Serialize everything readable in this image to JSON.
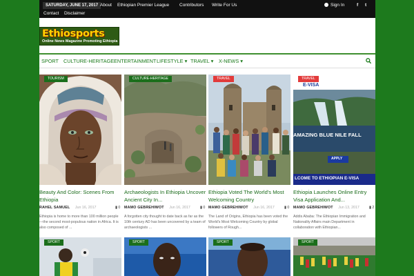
{
  "topbar": {
    "date": "SATURDAY, JUNE 17, 2017",
    "links": [
      "About",
      "Ethiopian Premier League",
      "Contributors",
      "Write For Us",
      "Contact",
      "Disclaimer"
    ],
    "signin": "Sign In",
    "social": [
      "f",
      "t"
    ]
  },
  "logo": {
    "brand": "Ethiosports",
    "tagline": "Online News Magazine Promoting Ethiopia"
  },
  "menu": {
    "items": [
      "SPORT",
      "CULTURE-HERITAGE",
      "ENTERTAINMENT",
      "LIFESTYLE",
      "TRAVEL",
      "X-NEWS"
    ],
    "search_icon": "search-icon"
  },
  "articles": [
    {
      "category": "TOURISM",
      "title": "Beauty And Color: Scenes From Ethiopia",
      "author": "RAHEL SAMUEL",
      "date": "Jun 16, 2017",
      "comments": "0",
      "excerpt": "Ethiopia is home to more than 100 million people—the second most-populous nation in Africa. It is also composed of ..."
    },
    {
      "category": "CULTURE-HERITAGE",
      "title": "Archaeologists In Ethiopia Uncover Ancient City In...",
      "author": "MAMO GEBREHIWOT",
      "date": "Jun 16, 2017",
      "comments": "0",
      "excerpt": "A forgotten city thought to date back as far as the 10th century AD has been uncovered by a team of archaeologists ..."
    },
    {
      "category": "TRAVEL",
      "title": "Ethiopia Voted The World's Most Welcoming Country",
      "author": "MAMO GEBREHIWOT",
      "date": "Jun 16, 2017",
      "comments": "0",
      "excerpt": "The Land of Origins, Ethiopia has been voted the World's Most Welcoming Country by global followers of Rough..."
    },
    {
      "category": "TRAVEL",
      "title": "Ethiopia Launches Online Entry Visa Application And...",
      "author": "MAMO GEBREHIWOT",
      "date": "Jun 13, 2017",
      "comments": "2",
      "excerpt": "Addis Ababa: The Ethiopian Immigration and Nationality Affairs main Department in collaboration with Ethiopian...",
      "image_text": {
        "top": "E-VISA",
        "headline": "AMAZING BLUE NILE FALL",
        "apply": "APPLY",
        "bottom": "LCOME TO ETHIOPIAN E-VISA"
      }
    }
  ],
  "second_row": [
    {
      "category": "SPORT"
    },
    {
      "category": "SPORT"
    },
    {
      "category": "SPORT"
    },
    {
      "category": "SPORT"
    }
  ],
  "colors": {
    "brand_green": "#1d7a1d",
    "link_green": "#1a6b1a",
    "badge_green": "#1b6e1b",
    "badge_red": "#e23b3b"
  }
}
